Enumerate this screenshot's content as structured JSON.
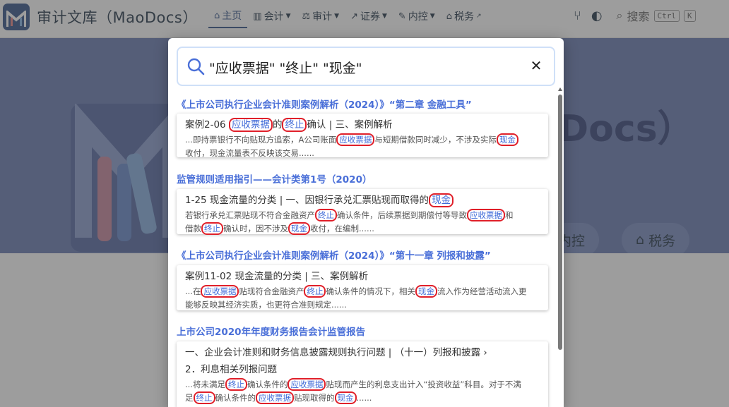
{
  "site": {
    "title": "审计文库（MaoDocs）",
    "hero_title": "Docs）",
    "hero_buttons": [
      "内控",
      "税务"
    ],
    "hero_button_icons": [
      "",
      "bank-icon"
    ]
  },
  "nav": {
    "items": [
      {
        "label": "主页",
        "icon": "home-icon",
        "active": true,
        "dropdown": false
      },
      {
        "label": "会计",
        "icon": "calculator-icon",
        "active": false,
        "dropdown": true
      },
      {
        "label": "审计",
        "icon": "scale-icon",
        "active": false,
        "dropdown": true
      },
      {
        "label": "证券",
        "icon": "chart-line-icon",
        "active": false,
        "dropdown": true
      },
      {
        "label": "内控",
        "icon": "wrench-icon",
        "active": false,
        "dropdown": true
      },
      {
        "label": "税务",
        "icon": "bank-icon",
        "active": false,
        "dropdown": false,
        "external": true
      }
    ],
    "search_label": "搜索",
    "kbd": [
      "Ctrl",
      "K"
    ]
  },
  "search": {
    "query": "\"应收票据\" \"终止\" \"现金\""
  },
  "results": [
    {
      "group": "《上市公司执行企业会计准则案例解析（2024）》“第二章 金融工具”",
      "heading": [
        "案例2-06 ",
        {
          "hl": "应收票据"
        },
        "的",
        {
          "hl": "终止"
        },
        "确认 | 三、案例解析"
      ],
      "lines": [
        [
          "...即持票银行不向贴现方追索，A公司账面",
          {
            "hl": "应收票据"
          },
          "与短期借款同时减少，不涉及实际",
          {
            "hl": "现金"
          }
        ],
        [
          "收付，现金流量表不反映该交易......"
        ]
      ]
    },
    {
      "group": "监管规则适用指引——会计类第1号（2020）",
      "heading": [
        "1-25 现金流量的分类 | 一、因银行承兑汇票贴现而取得的",
        {
          "hl": "现金"
        }
      ],
      "lines": [
        [
          "若银行承兑汇票贴现不符合金融资产",
          {
            "hl": "终止"
          },
          "确认条件，后续票据到期偿付等导致",
          {
            "hl": "应收票据"
          },
          "和"
        ],
        [
          "借款",
          {
            "hl": "终止"
          },
          "确认时，因不涉及",
          {
            "hl": "现金"
          },
          "收付，在编制......"
        ]
      ]
    },
    {
      "group": "《上市公司执行企业会计准则案例解析（2024）》“第十一章 列报和披露”",
      "heading": [
        "案例11-02 现金流量的分类 | 三、案例解析"
      ],
      "lines": [
        [
          "...在",
          {
            "hl": "应收票据"
          },
          "贴现符合金融资产",
          {
            "hl": "终止"
          },
          "确认条件的情况下，相关",
          {
            "hl": "现金"
          },
          "流入作为经营活动流入更"
        ],
        [
          "能够反映其经济实质，也更符合准则规定......"
        ]
      ]
    },
    {
      "group": "上市公司2020年年度财务报告会计监管报告",
      "heading": [
        "一、企业会计准则和财务信息披露规则执行问题 | （十一）列报和披露 ›"
      ],
      "heading2": [
        "2．利息相关列报问题"
      ],
      "lines": [
        [
          "...将未满足",
          {
            "hl": "终止"
          },
          "确认条件的",
          {
            "hl": "应收票据"
          },
          "贴现而产生的利息支出计入“投资收益”科目。对于不满"
        ],
        [
          "足",
          {
            "hl": "终止"
          },
          "确认条件的",
          {
            "hl": "应收票据"
          },
          "贴现取得的",
          {
            "hl": "现金"
          },
          "......"
        ]
      ]
    }
  ]
}
